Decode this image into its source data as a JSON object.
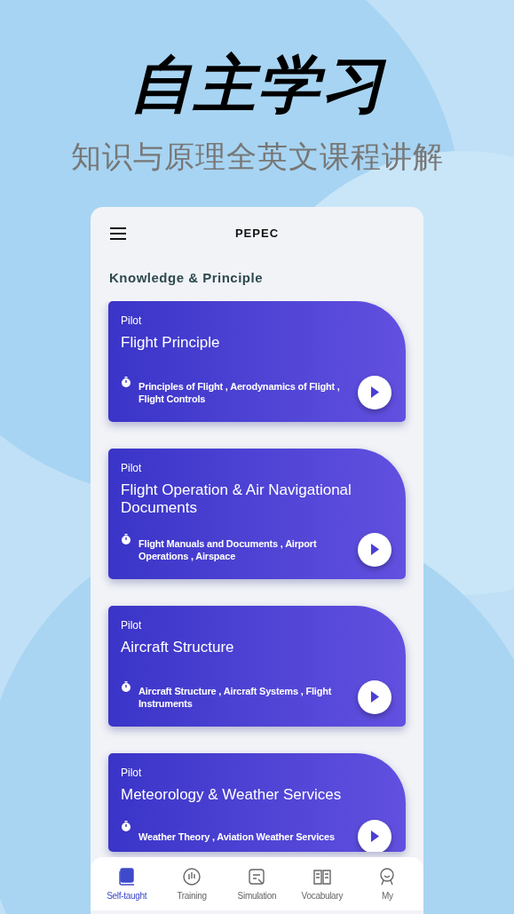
{
  "headline": "自主学习",
  "subtitle": "知识与原理全英文课程讲解",
  "app": {
    "title": "PEPEC",
    "section_title": "Knowledge & Principle",
    "courses": [
      {
        "category": "Pilot",
        "title": "Flight Principle",
        "topics": "Principles of Flight , Aerodynamics of Flight , Flight Controls"
      },
      {
        "category": "Pilot",
        "title": "Flight Operation & Air Navigational Documents",
        "topics": "Flight Manuals and Documents , Airport Operations , Airspace"
      },
      {
        "category": "Pilot",
        "title": "Aircraft Structure",
        "topics": "Aircraft Structure , Aircraft Systems , Flight Instruments"
      },
      {
        "category": "Pilot",
        "title": "Meteorology & Weather Services",
        "topics": "Weather Theory  , Aviation Weather Services"
      }
    ],
    "tabs": [
      {
        "label": "Self-taught",
        "selected": true
      },
      {
        "label": "Training",
        "selected": false
      },
      {
        "label": "Simulation",
        "selected": false
      },
      {
        "label": "Vocabulary",
        "selected": false
      },
      {
        "label": "My",
        "selected": false
      }
    ]
  }
}
